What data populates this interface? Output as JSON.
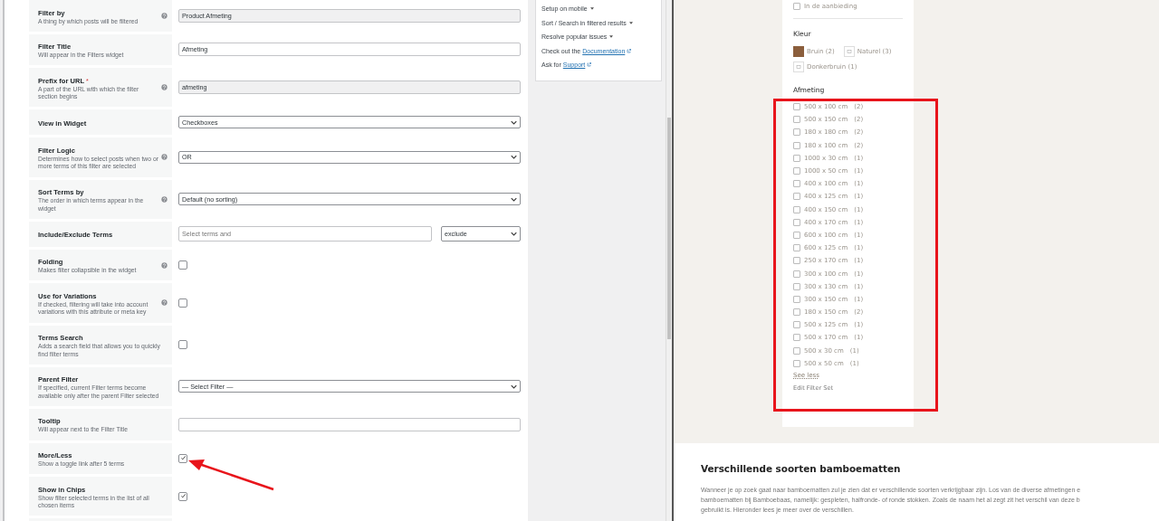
{
  "settings": [
    {
      "label": "Filter by",
      "description": "A thing by which posts will be filtered",
      "help": true,
      "kind": "text",
      "readonly": true,
      "value": "Product Afmeting"
    },
    {
      "label": "Filter Title",
      "description": "Will appear in the Filters widget",
      "help": false,
      "kind": "text",
      "readonly": false,
      "value": "Afmeting"
    },
    {
      "label": "Prefix for URL",
      "required_mark": "*",
      "description": "A part of the URL with which the filter section begins",
      "help": true,
      "kind": "text",
      "readonly": true,
      "value": "afmeting"
    },
    {
      "label": "View in Widget",
      "help": false,
      "kind": "select",
      "value": "Checkboxes"
    },
    {
      "label": "Filter Logic",
      "description": "Determines how to select posts when two or more terms of this filter are selected",
      "help": true,
      "kind": "select",
      "value": "OR"
    },
    {
      "label": "Sort Terms by",
      "description": "The order in which terms appear in the widget",
      "help": true,
      "kind": "select",
      "value": "Default (no sorting)"
    },
    {
      "label": "Include/Exclude Terms",
      "help": false,
      "kind": "terms",
      "placeholder": "Select terms and",
      "value": "exclude"
    },
    {
      "label": "Folding",
      "description": "Makes filter collapsible in the widget",
      "help": true,
      "kind": "checkbox",
      "checked": false
    },
    {
      "label": "Use for Variations",
      "description": "If checked, filtering will take into account variations with this attribute or meta key",
      "help": true,
      "kind": "checkbox",
      "checked": false
    },
    {
      "label": "Terms Search",
      "description": "Adds a search field that allows you to quickly find filter terms",
      "help": false,
      "kind": "checkbox",
      "checked": false
    },
    {
      "label": "Parent Filter",
      "description": "If specified, current Filter terms become available only after the parent Filter selected",
      "help": false,
      "kind": "select",
      "value": "— Select Filter —"
    },
    {
      "label": "Tooltip",
      "description": "Will appear next to the Filter Title",
      "help": false,
      "kind": "text",
      "readonly": false
    },
    {
      "label": "More/Less",
      "description": "Show a toggle link after 5 terms",
      "help": false,
      "kind": "checkbox",
      "checked": true
    },
    {
      "label": "Show in Chips",
      "description": "Show filter selected terms in the list of all chosen items",
      "help": false,
      "kind": "checkbox",
      "checked": true
    }
  ],
  "help_box": {
    "menus": [
      "Setup on mobile",
      "Sort / Search in filtered results",
      "Resolve popular issues"
    ],
    "links": [
      {
        "prefix": "Check out the",
        "link": "Documentation"
      },
      {
        "prefix": "Ask for",
        "link": "Support"
      }
    ]
  },
  "preview": {
    "on_sale": {
      "label": "In de aanbieding",
      "checked": false
    },
    "color_heading": "Kleur",
    "colors": [
      {
        "label": "Bruin (2)",
        "kind": "color",
        "color": "#8b5e3c"
      },
      {
        "label": "Naturel (3)",
        "kind": "image"
      },
      {
        "label": "Donkerbruin (1)",
        "kind": "image"
      }
    ],
    "size_heading": "Afmeting",
    "sizes": [
      {
        "label": "500 x 100 cm",
        "count": "(2)",
        "checked": false
      },
      {
        "label": "500 x 150 cm",
        "count": "(2)",
        "checked": false
      },
      {
        "label": "180 x 180 cm",
        "count": "(2)",
        "checked": false
      },
      {
        "label": "180 x 100 cm",
        "count": "(2)",
        "checked": false
      },
      {
        "label": "1000 x 30 cm",
        "count": "(1)",
        "checked": false
      },
      {
        "label": "1000 x 50 cm",
        "count": "(1)",
        "checked": false
      },
      {
        "label": "400 x 100 cm",
        "count": "(1)",
        "checked": false
      },
      {
        "label": "400 x 125 cm",
        "count": "(1)",
        "checked": false
      },
      {
        "label": "400 x 150 cm",
        "count": "(1)",
        "checked": false
      },
      {
        "label": "400 x 170 cm",
        "count": "(1)",
        "checked": false
      },
      {
        "label": "600 x 100 cm",
        "count": "(1)",
        "checked": false
      },
      {
        "label": "600 x 125 cm",
        "count": "(1)",
        "checked": false
      },
      {
        "label": "250 x 170 cm",
        "count": "(1)",
        "checked": false
      },
      {
        "label": "300 x 100 cm",
        "count": "(1)",
        "checked": false
      },
      {
        "label": "300 x 130 cm",
        "count": "(1)",
        "checked": false
      },
      {
        "label": "300 x 150 cm",
        "count": "(1)",
        "checked": false
      },
      {
        "label": "180 x 150 cm",
        "count": "(2)",
        "checked": false
      },
      {
        "label": "500 x 125 cm",
        "count": "(1)",
        "checked": false
      },
      {
        "label": "500 x 170 cm",
        "count": "(1)",
        "checked": false
      },
      {
        "label": "500 x 30 cm",
        "count": "(1)",
        "checked": false
      },
      {
        "label": "500 x 50 cm",
        "count": "(1)",
        "checked": false
      }
    ],
    "see_less": "See less",
    "edit_filter_set": "Edit Filter Set"
  },
  "article": {
    "heading": "Verschillende soorten bamboematten",
    "lines": [
      "Wanneer je op zoek gaat naar bamboematten zul je zien dat er verschillende soorten verkrijgbaar zijn. Los van de diverse afmetingen e",
      "bamboematten bij Bamboebaas, namelijk: gespleten, halfronde- of ronde stokken.  Zoals de naam het al zegt zit het verschil van deze b",
      "gebruikt is. Hieronder lees je meer over de verschillen."
    ]
  }
}
